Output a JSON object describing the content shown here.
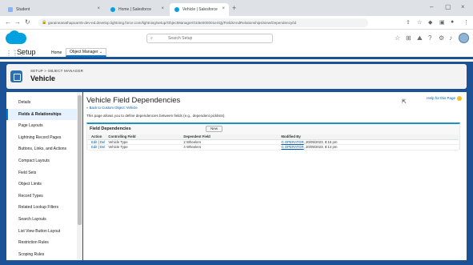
{
  "browser": {
    "tabs": [
      {
        "label": "Student",
        "active": false
      },
      {
        "label": "Home | Salesforce",
        "active": false
      },
      {
        "label": "Vehicle | Salesforce",
        "active": true
      }
    ],
    "url": "garaineanathapoarn5-dev-ed.develop.lightning.force.com/lightning/setup/ObjectManager/01I5e000001eXQj/FieldsAndRelationships/view/Dependency/id",
    "new_tab": "+"
  },
  "header": {
    "search_placeholder": "Search Setup",
    "brand_color": "#00a1e0"
  },
  "setup_nav": {
    "title": "Setup",
    "home": "Home",
    "object_manager": "Object Manager"
  },
  "object": {
    "breadcrumb": "SETUP > OBJECT MANAGER",
    "name": "Vehicle",
    "accent": "#1b5297"
  },
  "sidebar": {
    "items": [
      {
        "label": "Details",
        "active": false
      },
      {
        "label": "Fields & Relationships",
        "active": true
      },
      {
        "label": "Page Layouts",
        "active": false
      },
      {
        "label": "Lightning Record Pages",
        "active": false
      },
      {
        "label": "Buttons, Links, and Actions",
        "active": false
      },
      {
        "label": "Compact Layouts",
        "active": false
      },
      {
        "label": "Field Sets",
        "active": false
      },
      {
        "label": "Object Limits",
        "active": false
      },
      {
        "label": "Record Types",
        "active": false
      },
      {
        "label": "Related Lookup Filters",
        "active": false
      },
      {
        "label": "Search Layouts",
        "active": false
      },
      {
        "label": "List View Button Layout",
        "active": false
      },
      {
        "label": "Restriction Rules",
        "active": false
      },
      {
        "label": "Scoping Rules",
        "active": false
      }
    ]
  },
  "main": {
    "title": "Vehicle Field Dependencies",
    "back_link": "« Back to Custom Object: Vehicle",
    "help_link": "Help for this Page",
    "description": "This page allows you to define dependencies between fields (e.g., dependent picklists).",
    "section_title": "Field Dependencies",
    "new_button": "New",
    "columns": [
      "Action",
      "Controlling Field",
      "Dependent Field",
      "Modified By"
    ],
    "rows": [
      {
        "edit": "Edit",
        "del": "Del",
        "controlling": "Vehicle Type",
        "dependent": "2 Wheelers",
        "modified_by": "G OPERATOR",
        "modified_at": ", 20/09/2023, 8:15 pm"
      },
      {
        "edit": "Edit",
        "del": "Del",
        "controlling": "Vehicle Type",
        "dependent": "4 Wheelers",
        "modified_by": "G OPERATOR",
        "modified_at": ", 20/09/2023, 8:14 pm"
      }
    ]
  }
}
